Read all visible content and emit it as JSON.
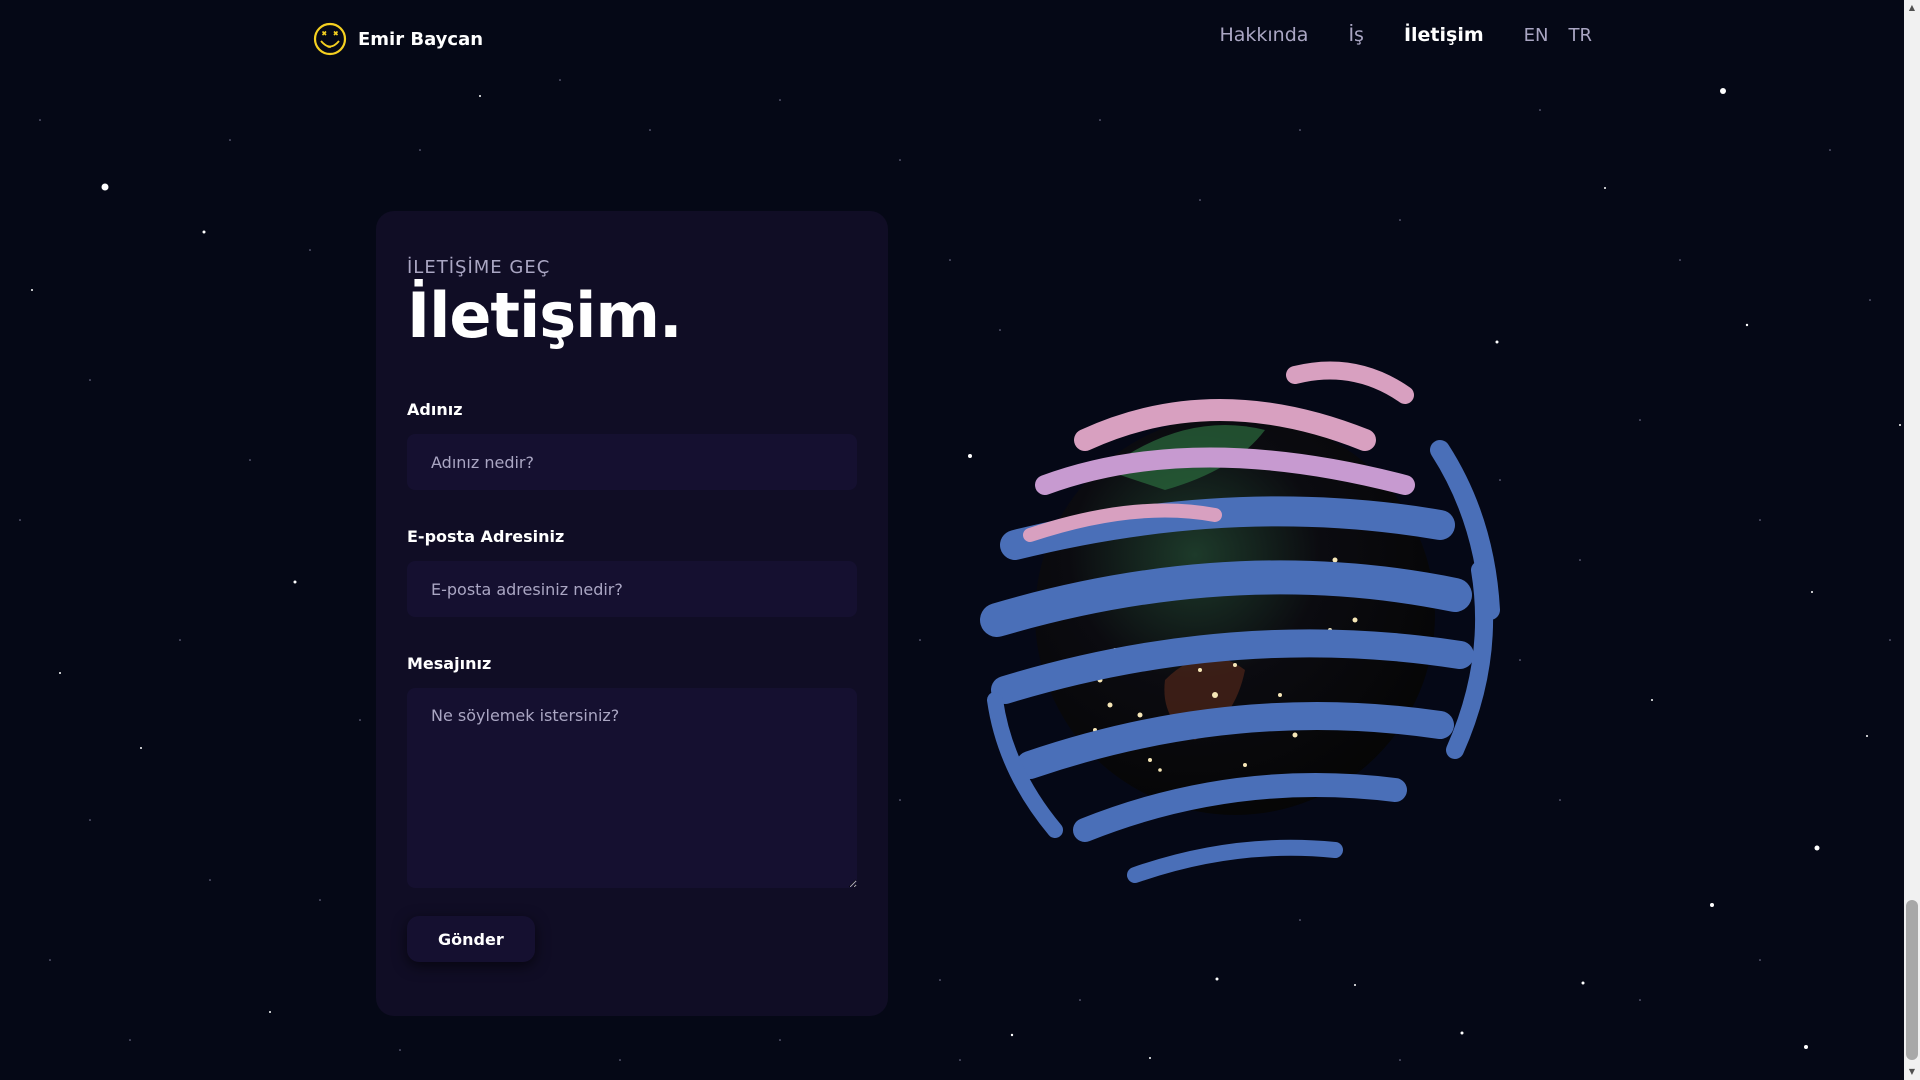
{
  "brand": {
    "name": "Emir Baycan",
    "logo_icon": "smiley-face-icon",
    "accent": "#f5d020"
  },
  "nav": {
    "links": [
      {
        "label": "Hakkında",
        "active": false
      },
      {
        "label": "İş",
        "active": false
      },
      {
        "label": "İletişim",
        "active": true
      }
    ],
    "languages": [
      "EN",
      "TR"
    ]
  },
  "contact": {
    "subtitle": "İLETİŞİME GEÇ",
    "title": "İletişim.",
    "name_label": "Adınız",
    "name_placeholder": "Adınız nedir?",
    "email_label": "E-posta Adresiniz",
    "email_placeholder": "E-posta adresiniz nedir?",
    "message_label": "Mesajınız",
    "message_placeholder": "Ne söylemek istersiniz?",
    "submit_label": "Gönder"
  },
  "colors": {
    "background": "#050816",
    "card": "#100d25",
    "input": "#151030",
    "muted_text": "#aaa6c3",
    "globe_ribbons": "#4a6fb8",
    "globe_ribbon_highlight": "#d8a0c0"
  }
}
